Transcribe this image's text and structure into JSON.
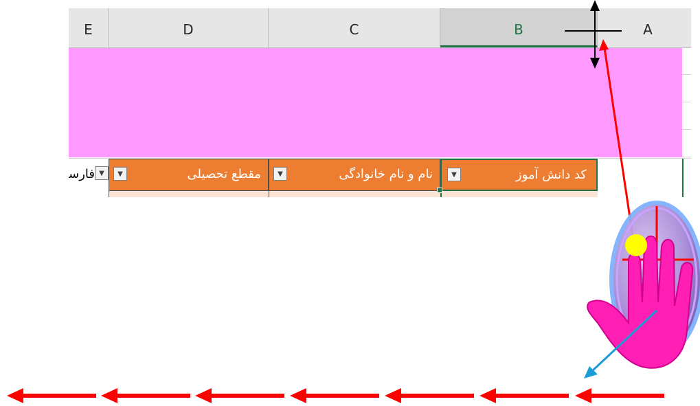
{
  "columns": [
    "E",
    "D",
    "C",
    "B",
    "A"
  ],
  "selected_column": "B",
  "header_cells": {
    "student_code": "کد دانش آموز",
    "full_name": "نام و نام خانوادگی",
    "grade_level": "مقطع تحصیلی",
    "partial": "فارسی"
  },
  "colors": {
    "pink_band": "#ff99ff",
    "header_fill": "#ed7d31",
    "row_fill": "#fbe4d5",
    "selection_green": "#217346",
    "arrow_red": "#ff0000",
    "hand_magenta": "#ff1493",
    "blue_arrow": "#1e9bd7",
    "click_dot": "#ffff00"
  },
  "icons": [
    "resize-cursor-icon",
    "dropdown-arrow-icon",
    "mouse-hand-icon",
    "left-arrow-icon"
  ]
}
